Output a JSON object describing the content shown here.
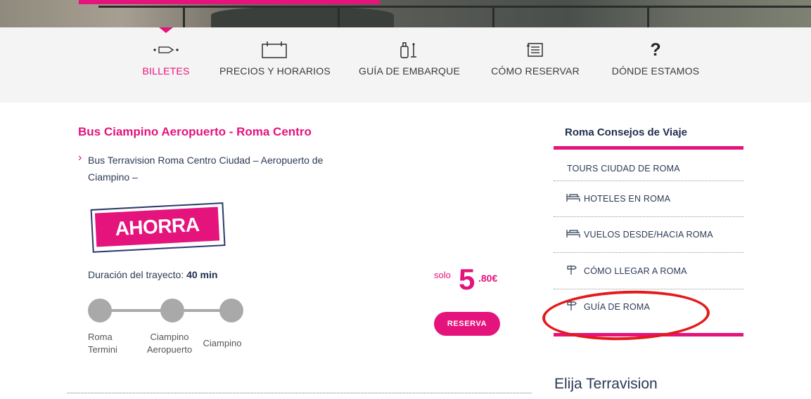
{
  "nav": {
    "items": [
      {
        "label": "BILLETES",
        "icon": "ticket-icon",
        "active": true
      },
      {
        "label": "PRECIOS Y HORARIOS",
        "icon": "calendar-icon",
        "active": false
      },
      {
        "label": "GUÍA DE EMBARQUE",
        "icon": "luggage-icon",
        "active": false
      },
      {
        "label": "CÓMO RESERVAR",
        "icon": "booking-icon",
        "active": false
      },
      {
        "label": "DÓNDE ESTAMOS",
        "icon": "question-icon",
        "glyph": "?",
        "active": false
      }
    ],
    "active_color": "#e5137c"
  },
  "main": {
    "title": "Bus Ciampino Aeropuerto - Roma Centro",
    "route_link": "Bus Terravision Roma Centro Ciudad – Aeropuerto de Ciampino –",
    "stamp_text": "AHORRA",
    "duration_label": "Duración del trayecto:",
    "duration_value": "40 min",
    "stops": [
      "Roma Termini",
      "Ciampino Aeropuerto",
      "Ciampino"
    ],
    "price": {
      "prefix": "solo",
      "integer": "5",
      "decimal": ".80€"
    },
    "reserve_label": "RESERVA"
  },
  "sidebar": {
    "title": "Roma Consejos de Viaje",
    "items": [
      {
        "label": "TOURS CIUDAD DE ROMA",
        "icon": ""
      },
      {
        "label": "HOTELES EN ROMA",
        "icon": "bed-icon"
      },
      {
        "label": "VUELOS DESDE/HACIA ROMA",
        "icon": "bed-icon"
      },
      {
        "label": "CÓMO LLEGAR A ROMA",
        "icon": "signpost-icon"
      },
      {
        "label": "GUÍA DE ROMA",
        "icon": "signpost-icon",
        "highlighted": true
      }
    ],
    "footer_title": "Elija Terravision"
  },
  "colors": {
    "brand": "#e5137c",
    "navy": "#1f2d4d",
    "highlight": "#e41a1a"
  }
}
